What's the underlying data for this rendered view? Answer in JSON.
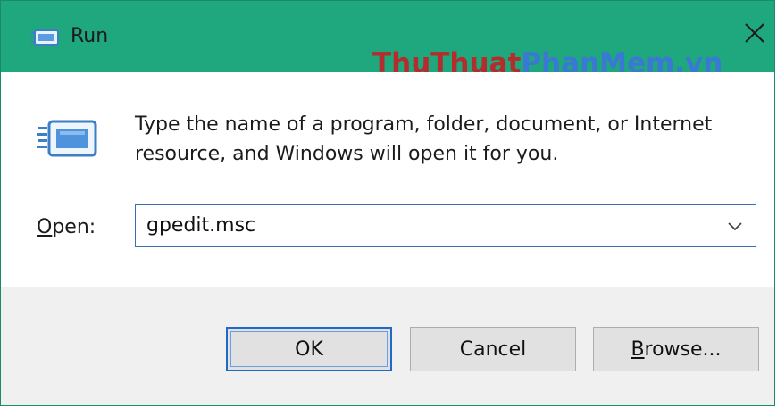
{
  "window": {
    "title": "Run"
  },
  "watermark": {
    "part1": "ThuThuat",
    "part2": "PhanMem.vn"
  },
  "dialog": {
    "description": "Type the name of a program, folder, document, or Internet resource, and Windows will open it for you.",
    "open_label_accel": "O",
    "open_label_rest": "pen:",
    "open_value": "gpedit.msc"
  },
  "buttons": {
    "ok": "OK",
    "cancel": "Cancel",
    "browse_accel": "B",
    "browse_rest": "rowse..."
  },
  "colors": {
    "titlebar": "#1fa77e",
    "footer": "#f0f0f0",
    "focus_border": "#1f69c8"
  },
  "icons": {
    "title": "run-icon",
    "close": "close-icon",
    "dropdown": "chevron-down-icon"
  }
}
